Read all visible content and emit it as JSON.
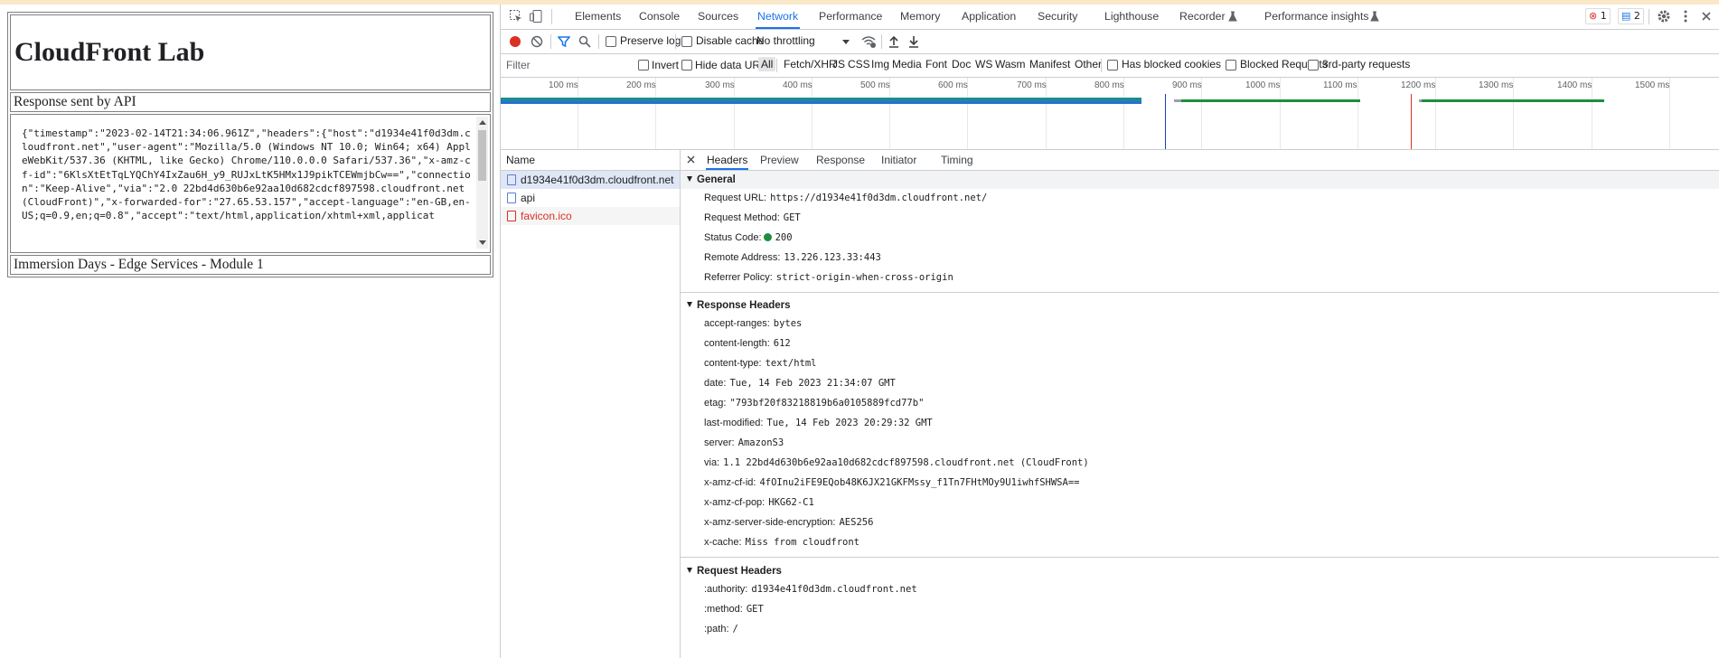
{
  "page": {
    "title": "CloudFront Lab",
    "response_label": "Response sent by API",
    "response_body": "{\"timestamp\":\"2023-02-14T21:34:06.961Z\",\"headers\":{\"host\":\"d1934e41f0d3dm.cloudfront.net\",\"user-agent\":\"Mozilla/5.0 (Windows NT 10.0; Win64; x64) AppleWebKit/537.36 (KHTML, like Gecko) Chrome/110.0.0.0 Safari/537.36\",\"x-amz-cf-id\":\"6KlsXtEtTqLYQChY4IxZau6H_y9_RUJxLtK5HMx1J9pikTCEWmjbCw==\",\"connection\":\"Keep-Alive\",\"via\":\"2.0 22bd4d630b6e92aa10d682cdcf897598.cloudfront.net (CloudFront)\",\"x-forwarded-for\":\"27.65.53.157\",\"accept-language\":\"en-GB,en-US;q=0.9,en;q=0.8\",\"accept\":\"text/html,application/xhtml+xml,applicat",
    "footer": "Immersion Days - Edge Services - Module 1"
  },
  "devtools": {
    "tabs": [
      "Elements",
      "Console",
      "Sources",
      "Network",
      "Performance",
      "Memory",
      "Application",
      "Security",
      "Lighthouse",
      "Recorder",
      "Performance insights"
    ],
    "active_tab": "Network",
    "error_count": "1",
    "message_count": "2",
    "toolbar": {
      "preserve_log": "Preserve log",
      "disable_cache": "Disable cache",
      "throttling": "No throttling"
    },
    "filter": {
      "placeholder": "Filter",
      "invert": "Invert",
      "hide_data_urls": "Hide data URLs",
      "types": [
        "All",
        "Fetch/XHR",
        "JS",
        "CSS",
        "Img",
        "Media",
        "Font",
        "Doc",
        "WS",
        "Wasm",
        "Manifest",
        "Other"
      ],
      "has_blocked_cookies": "Has blocked cookies",
      "blocked_requests": "Blocked Requests",
      "third_party": "3rd-party requests"
    },
    "timeline_ticks": [
      "100 ms",
      "200 ms",
      "300 ms",
      "400 ms",
      "500 ms",
      "600 ms",
      "700 ms",
      "800 ms",
      "900 ms",
      "1000 ms",
      "1100 ms",
      "1200 ms",
      "1300 ms",
      "1400 ms",
      "1500 ms"
    ],
    "requests": {
      "header": "Name",
      "items": [
        {
          "name": "d1934e41f0d3dm.cloudfront.net",
          "error": false
        },
        {
          "name": "api",
          "error": false
        },
        {
          "name": "favicon.ico",
          "error": true
        }
      ]
    },
    "detail_tabs": [
      "Headers",
      "Preview",
      "Response",
      "Initiator",
      "Timing"
    ],
    "general": {
      "title": "General",
      "rows": [
        {
          "k": "Request URL:",
          "v": "https://d1934e41f0d3dm.cloudfront.net/"
        },
        {
          "k": "Request Method:",
          "v": "GET"
        },
        {
          "k": "Status Code:",
          "v": "200"
        },
        {
          "k": "Remote Address:",
          "v": "13.226.123.33:443"
        },
        {
          "k": "Referrer Policy:",
          "v": "strict-origin-when-cross-origin"
        }
      ]
    },
    "response_headers": {
      "title": "Response Headers",
      "rows": [
        {
          "k": "accept-ranges:",
          "v": "bytes"
        },
        {
          "k": "content-length:",
          "v": "612"
        },
        {
          "k": "content-type:",
          "v": "text/html"
        },
        {
          "k": "date:",
          "v": "Tue, 14 Feb 2023 21:34:07 GMT"
        },
        {
          "k": "etag:",
          "v": "\"793bf20f83218819b6a0105889fcd77b\""
        },
        {
          "k": "last-modified:",
          "v": "Tue, 14 Feb 2023 20:29:32 GMT"
        },
        {
          "k": "server:",
          "v": "AmazonS3"
        },
        {
          "k": "via:",
          "v": "1.1 22bd4d630b6e92aa10d682cdcf897598.cloudfront.net (CloudFront)"
        },
        {
          "k": "x-amz-cf-id:",
          "v": "4fOInu2iFE9EQob48K6JX21GKFMssy_f1Tn7FHtMOy9U1iwhfSHWSA=="
        },
        {
          "k": "x-amz-cf-pop:",
          "v": "HKG62-C1"
        },
        {
          "k": "x-amz-server-side-encryption:",
          "v": "AES256"
        },
        {
          "k": "x-cache:",
          "v": "Miss from cloudfront"
        }
      ]
    },
    "request_headers": {
      "title": "Request Headers",
      "rows": [
        {
          "k": ":authority:",
          "v": "d1934e41f0d3dm.cloudfront.net"
        },
        {
          "k": ":method:",
          "v": "GET"
        },
        {
          "k": ":path:",
          "v": "/"
        }
      ]
    },
    "colors": {
      "accent": "#1a73e8",
      "record": "#d93025",
      "status_ok": "#1e8e3e"
    }
  }
}
